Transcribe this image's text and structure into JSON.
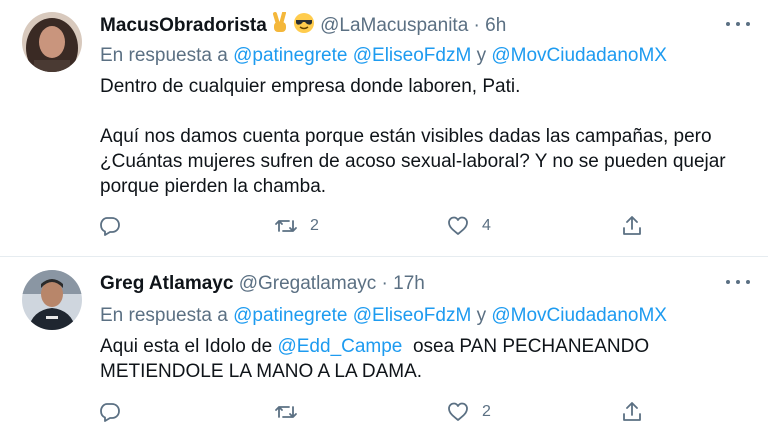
{
  "tweets": [
    {
      "name": "MacusObradorista",
      "handle": "@LaMacuspanita",
      "time": "6h",
      "reply_prefix": "En respuesta a",
      "mentions": [
        "@patinegrete",
        "@EliseoFdzM",
        "@MovCiudadanoMX"
      ],
      "conj": "y",
      "text_paras": [
        "Dentro de cualquier empresa donde laboren, Pati.",
        "Aquí nos damos cuenta porque están visibles dadas las campañas, pero ¿Cuántas mujeres sufren de acoso sexual-laboral? Y no se pueden quejar porque pierden la chamba."
      ],
      "retweets": "2",
      "likes": "4"
    },
    {
      "name": "Greg Atlamayc",
      "handle": "@Gregatlamayc",
      "time": "17h",
      "reply_prefix": "En respuesta a",
      "mentions": [
        "@patinegrete",
        "@EliseoFdzM",
        "@MovCiudadanoMX"
      ],
      "conj": "y",
      "text_before": "Aqui esta el Idolo de ",
      "text_mention": "@Edd_Campe",
      "text_after": "  osea PAN PECHANEANDO METIENDOLE LA MANO A LA DAMA.",
      "likes": "2"
    }
  ],
  "separator": "·",
  "icons": [
    "more-icon",
    "reply-icon",
    "retweet-icon",
    "like-icon",
    "share-icon",
    "victory-hand-emoji",
    "sunglasses-emoji"
  ],
  "colors": {
    "mention": "#1d9bf0",
    "muted": "#5b7083",
    "text": "#0f1419"
  }
}
